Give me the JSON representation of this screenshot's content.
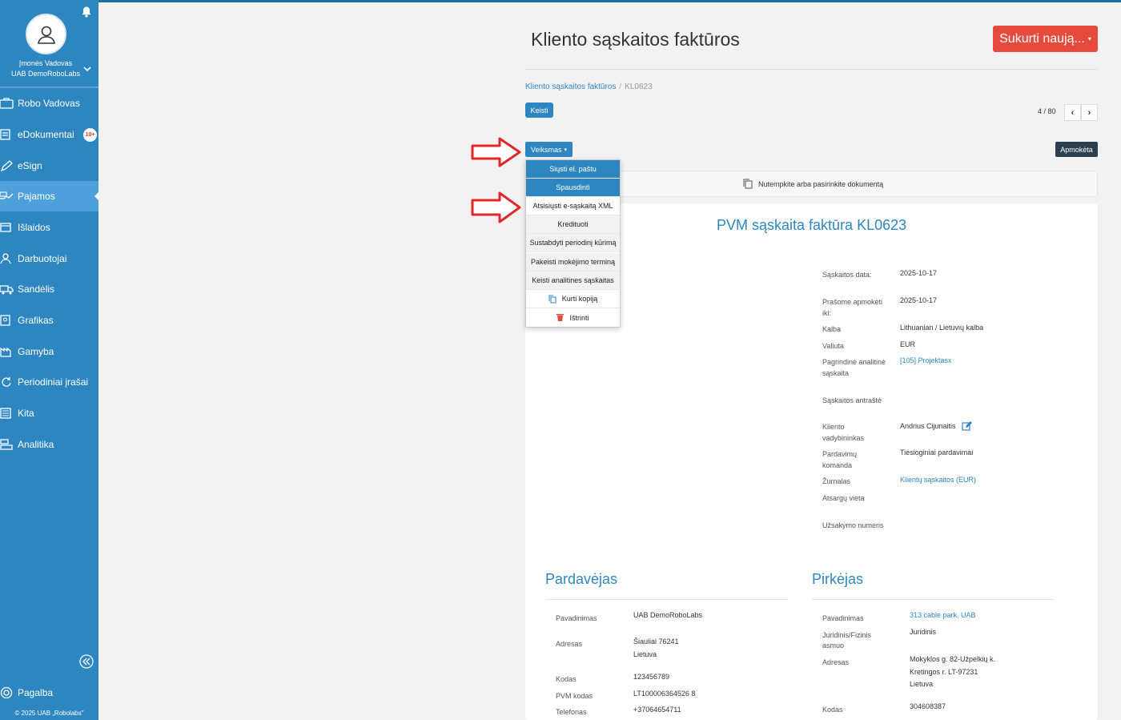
{
  "sidebar": {
    "user_role": "Įmonės Vadovas",
    "company": "UAB DemoRoboLabs",
    "items": [
      {
        "label": "Robo Vadovas",
        "icon": "briefcase-icon"
      },
      {
        "label": "eDokumentai",
        "icon": "document-icon",
        "badge": "10+"
      },
      {
        "label": "eSign",
        "icon": "pen-icon"
      },
      {
        "label": "Pajamos",
        "icon": "income-icon",
        "active": true
      },
      {
        "label": "Išlaidos",
        "icon": "expenses-icon"
      },
      {
        "label": "Darbuotojai",
        "icon": "employees-icon"
      },
      {
        "label": "Sandėlis",
        "icon": "truck-icon"
      },
      {
        "label": "Grafikas",
        "icon": "schedule-icon"
      },
      {
        "label": "Gamyba",
        "icon": "factory-icon"
      },
      {
        "label": "Periodiniai įrašai",
        "icon": "refresh-icon"
      },
      {
        "label": "Kita",
        "icon": "list-icon"
      },
      {
        "label": "Analitika",
        "icon": "analytics-icon"
      }
    ],
    "help": "Pagalba",
    "copyright": "© 2025 UAB „Robolabs\""
  },
  "header": {
    "title": "Kliento sąskaitos faktūros",
    "create_button": "Sukurti naują...",
    "breadcrumb_link": "Kliento sąskaitos faktūros",
    "breadcrumb_sep": "/",
    "breadcrumb_current": "KL0623",
    "edit_button": "Keisti",
    "pager": "4 / 80",
    "action_button": "Veiksmas",
    "paid_badge": "Apmokėta"
  },
  "action_menu": [
    "Siųsti el. paštu",
    "Spausdinti",
    "Atsisiųsti e-sąskaitą XML",
    "Kredituoti",
    "Sustabdyti periodinį kūrimą",
    "Pakeisti mokėjimo terminą",
    "Keisti analitines sąskaitas",
    "Kurti kopiją",
    "Ištrinti"
  ],
  "dropzone_text": "Nutempkite arba pasirinkite dokumentą",
  "document": {
    "title": "PVM sąskaita faktūra KL0623",
    "properties": [
      {
        "label": "Sąskaitos data:",
        "value": "2025-10-17"
      },
      {
        "label": "Prašome apmokėti iki:",
        "value": "2025-10-17"
      },
      {
        "label": "Kalba",
        "value": "Lithuanian / Lietuvių kalba"
      },
      {
        "label": "Valiuta",
        "value": "EUR"
      },
      {
        "label": "Pagrindinė analitinė sąskaita",
        "value": "[105] Projektasx"
      },
      {
        "label": "Sąskaitos antraštė",
        "value": ""
      },
      {
        "label": "Kliento vadybininkas",
        "value": "Andrius Cijunaitis"
      },
      {
        "label": "Pardavimų komanda",
        "value": "Tiesioginiai pardavimai"
      },
      {
        "label": "Žurnalas",
        "value": "Klientų sąskaitos (EUR)"
      },
      {
        "label": "Atsargų vieta",
        "value": ""
      },
      {
        "label": "Užsakymo numeris",
        "value": ""
      }
    ],
    "seller": {
      "title": "Pardavėjas",
      "name_label": "Pavadinimas",
      "name": "UAB DemoRoboLabs",
      "address_label": "Adresas",
      "address_line1": "Šiauliai  76241",
      "address_line2": "Lietuva",
      "code_label": "Kodas",
      "code": "123456789",
      "vat_label": "PVM kodas",
      "vat": "LT100006364526 8",
      "phone_label": "Telefonas",
      "phone": "+37064654711"
    },
    "buyer": {
      "title": "Pirkėjas",
      "name_label": "Pavadinimas",
      "name": "313 cable park, UAB",
      "type_label": "Juridinis/Fizinis asmuo",
      "type": "Juridinis",
      "address_label": "Adresas",
      "address_line1": "Mokyklos g. 82-Užpelkių k.",
      "address_line2": "Kretingos r. LT-97231",
      "address_line3": "Lietuva",
      "code_label": "Kodas",
      "code": "304608387"
    }
  },
  "colors": {
    "sidebar": "#2e86c1",
    "accent": "#2e86c1",
    "danger": "#e64a3d",
    "annotation_arrow": "#e0282b"
  }
}
